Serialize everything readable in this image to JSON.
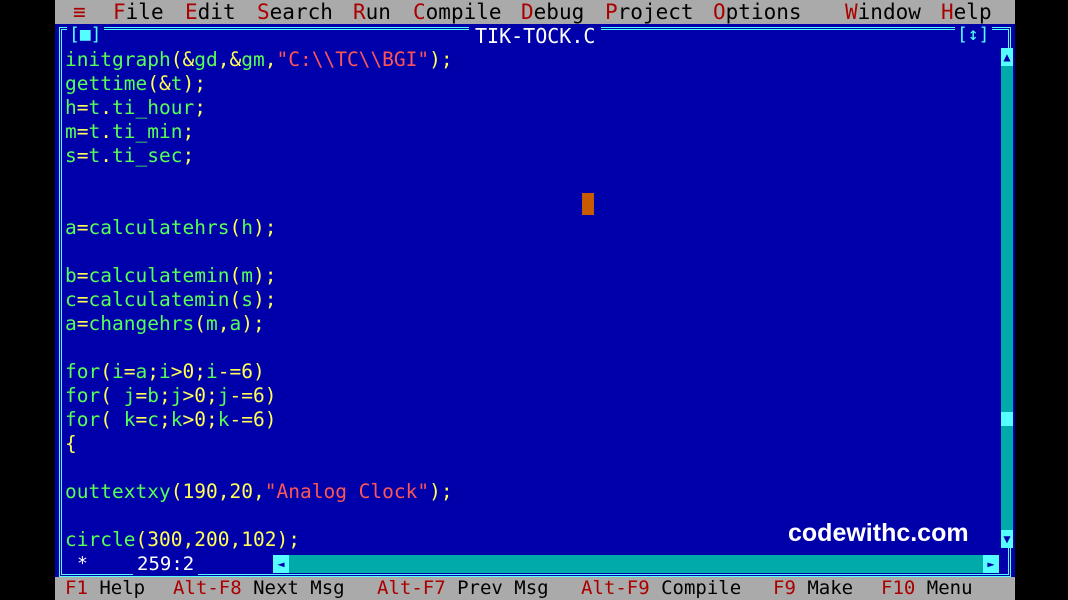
{
  "menu": {
    "system": "≡",
    "items": [
      {
        "hotkey": "F",
        "rest": "ile"
      },
      {
        "hotkey": "E",
        "rest": "dit"
      },
      {
        "hotkey": "S",
        "rest": "earch"
      },
      {
        "hotkey": "R",
        "rest": "un"
      },
      {
        "hotkey": "C",
        "rest": "ompile"
      },
      {
        "hotkey": "D",
        "rest": "ebug"
      },
      {
        "hotkey": "P",
        "rest": "roject"
      },
      {
        "hotkey": "O",
        "rest": "ptions"
      },
      {
        "hotkey": "W",
        "rest": "indow"
      },
      {
        "hotkey": "H",
        "rest": "elp"
      }
    ]
  },
  "window": {
    "title": "TIK-TOCK.C",
    "close_button": "[■]",
    "zoom_button": "[↕]"
  },
  "code_lines": [
    {
      "a": "initgraph(&gd,&gm,",
      "s": "\"C:\\\\TC\\\\BGI\"",
      "b": ");"
    },
    {
      "a": "gettime(&t);",
      "s": "",
      "b": ""
    },
    {
      "a": "h=t.ti_hour;",
      "s": "",
      "b": ""
    },
    {
      "a": "m=t.ti_min;",
      "s": "",
      "b": ""
    },
    {
      "a": "s=t.ti_sec;",
      "s": "",
      "b": ""
    },
    {
      "a": "",
      "s": "",
      "b": ""
    },
    {
      "a": "",
      "s": "",
      "b": ""
    },
    {
      "a": "a=calculatehrs(h);",
      "s": "",
      "b": ""
    },
    {
      "a": "",
      "s": "",
      "b": ""
    },
    {
      "a": "b=calculatemin(m);",
      "s": "",
      "b": ""
    },
    {
      "a": "c=calculatemin(s);",
      "s": "",
      "b": ""
    },
    {
      "a": "a=changehrs(m,a);",
      "s": "",
      "b": ""
    },
    {
      "a": "",
      "s": "",
      "b": ""
    },
    {
      "a": "for(i=a;i>0;i-=6)",
      "s": "",
      "b": ""
    },
    {
      "a": "for( j=b;j>0;j-=6)",
      "s": "",
      "b": ""
    },
    {
      "a": "for( k=c;k>0;k-=6)",
      "s": "",
      "b": ""
    },
    {
      "a": "{",
      "s": "",
      "b": ""
    },
    {
      "a": "",
      "s": "",
      "b": ""
    },
    {
      "a": "outtextxy(190,20,",
      "s": "\"Analog Clock\"",
      "b": ");"
    },
    {
      "a": "",
      "s": "",
      "b": ""
    },
    {
      "a": "circle(300,200,102);",
      "s": "",
      "b": ""
    }
  ],
  "status": {
    "modified_marker": "*",
    "position": "259:2"
  },
  "helpbar": [
    {
      "key": "F1",
      "label": " Help"
    },
    {
      "key": "Alt-F8",
      "label": " Next Msg"
    },
    {
      "key": "Alt-F7",
      "label": " Prev Msg"
    },
    {
      "key": "Alt-F9",
      "label": " Compile"
    },
    {
      "key": "F9",
      "label": " Make"
    },
    {
      "key": "F10",
      "label": " Menu"
    }
  ],
  "watermark": "codewithc.com",
  "colors": {
    "editor_bg": "#0000aa",
    "menu_bg": "#aaaaaa",
    "hotkey": "#aa0000",
    "frame": "#55ffff",
    "code_text": "#55ff55",
    "punct": "#ffff55",
    "string": "#ff5555",
    "cursor": "#c85a00"
  }
}
